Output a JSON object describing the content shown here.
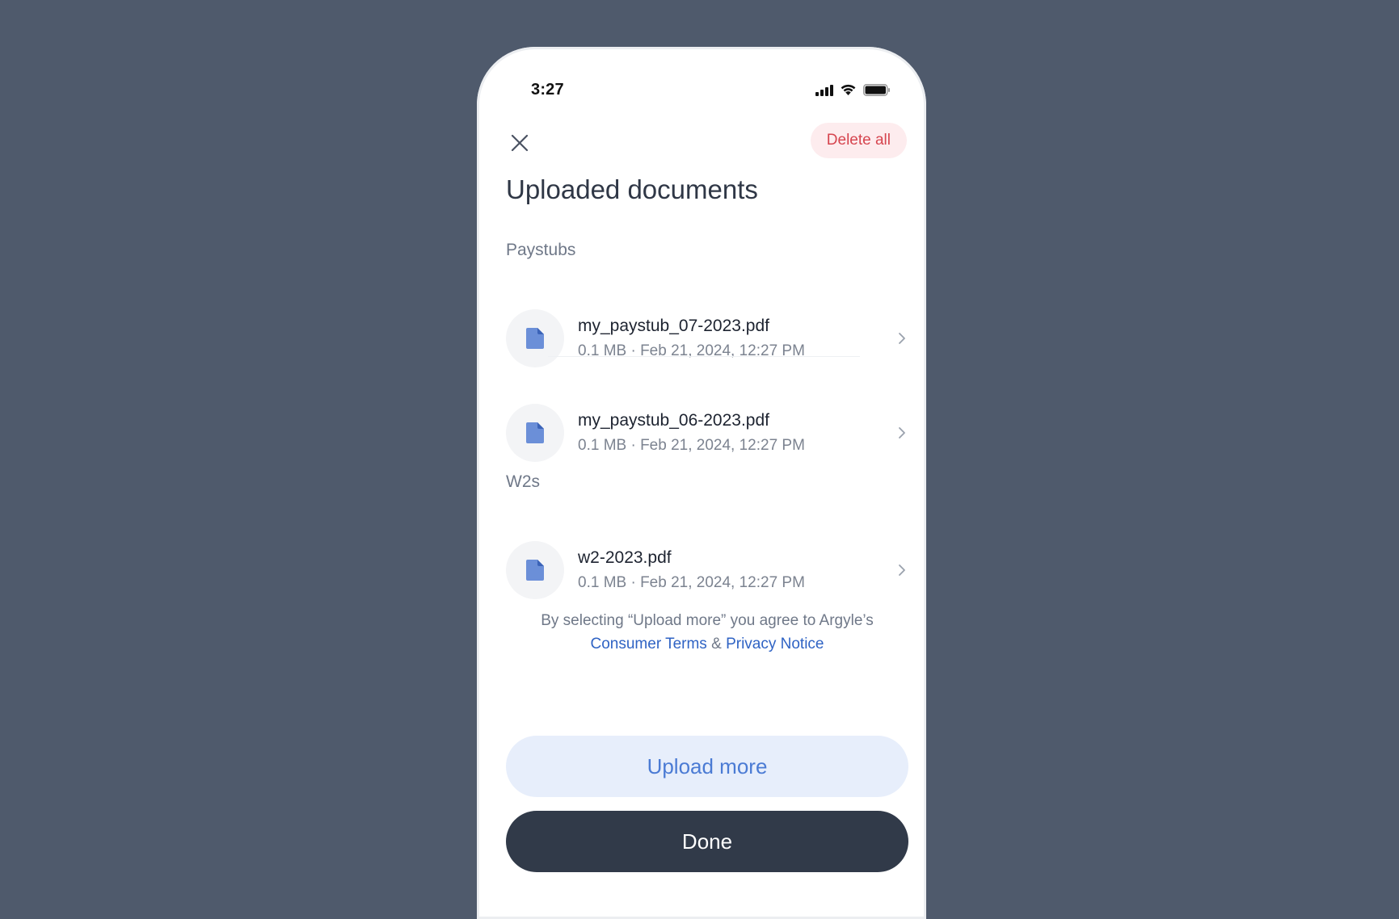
{
  "status_bar": {
    "time": "3:27",
    "icons": [
      "cellular-signal-icon",
      "wifi-icon",
      "battery-icon"
    ]
  },
  "header": {
    "close_icon": "close-icon",
    "delete_all_label": "Delete all",
    "title": "Uploaded documents"
  },
  "sections": [
    {
      "label": "Paystubs",
      "files": [
        {
          "name": "my_paystub_07-2023.pdf",
          "meta": "0.1 MB · Feb 21, 2024, 12:27 PM"
        },
        {
          "name": "my_paystub_06-2023.pdf",
          "meta": "0.1 MB · Feb 21, 2024, 12:27 PM"
        }
      ]
    },
    {
      "label": "W2s",
      "files": [
        {
          "name": "w2-2023.pdf",
          "meta": "0.1 MB · Feb 21, 2024, 12:27 PM"
        }
      ]
    }
  ],
  "legal": {
    "text": "By selecting “Upload more” you agree to Argyle’s",
    "terms_link": "Consumer Terms",
    "separator": "&",
    "privacy_link": "Privacy Notice"
  },
  "actions": {
    "upload_more_label": "Upload more",
    "done_label": "Done"
  },
  "colors": {
    "background": "#4f5a6c",
    "danger": "#d6454f",
    "danger_bg": "#fdecee",
    "link": "#2f63c4",
    "upload_bg": "#e7eefb",
    "upload_text": "#4b7bd4",
    "done_bg": "#313a49",
    "file_icon": "#6b8fd8"
  }
}
